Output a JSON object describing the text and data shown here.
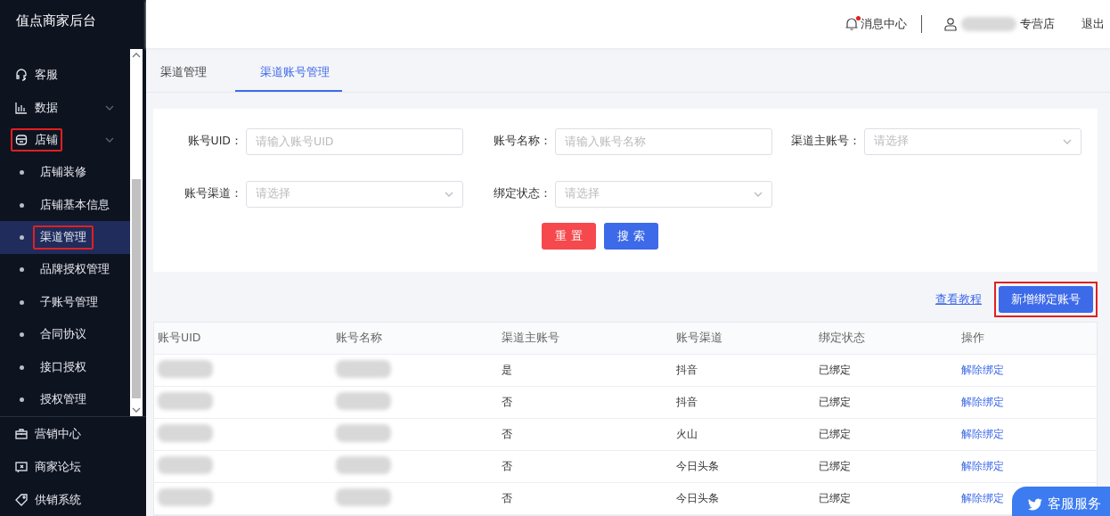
{
  "sidebar": {
    "title": "值点商家后台",
    "items": [
      {
        "label": "客服",
        "kind": "headset",
        "expandable": false,
        "highlighted": false
      },
      {
        "label": "数据",
        "kind": "chart",
        "expandable": true,
        "highlighted": false
      },
      {
        "label": "店铺",
        "kind": "shop",
        "expandable": true,
        "highlighted": true,
        "children": [
          {
            "label": "店铺装修",
            "selected": false,
            "highlighted": false
          },
          {
            "label": "店铺基本信息",
            "selected": false,
            "highlighted": false
          },
          {
            "label": "渠道管理",
            "selected": true,
            "highlighted": true
          },
          {
            "label": "品牌授权管理",
            "selected": false,
            "highlighted": false
          },
          {
            "label": "子账号管理",
            "selected": false,
            "highlighted": false
          },
          {
            "label": "合同协议",
            "selected": false,
            "highlighted": false
          },
          {
            "label": "接口授权",
            "selected": false,
            "highlighted": false
          },
          {
            "label": "授权管理",
            "selected": false,
            "highlighted": false
          }
        ]
      }
    ],
    "footer_items": [
      {
        "label": "营销中心",
        "kind": "briefcase"
      },
      {
        "label": "商家论坛",
        "kind": "forum"
      },
      {
        "label": "供销系统",
        "kind": "tag"
      }
    ]
  },
  "header": {
    "notifications": {
      "label": "消息中心",
      "unread": true
    },
    "shop_name_suffix": "专营店",
    "logout": "退出"
  },
  "tabs": [
    {
      "label": "渠道管理",
      "selected": false
    },
    {
      "label": "渠道账号管理",
      "selected": true
    }
  ],
  "filters": [
    {
      "label": "账号UID：",
      "kind": "input",
      "placeholder": "请输入账号UID"
    },
    {
      "label": "账号名称：",
      "kind": "input",
      "placeholder": "请输入账号名称"
    },
    {
      "label": "渠道主账号：",
      "kind": "select",
      "placeholder": "请选择"
    },
    {
      "label": "账号渠道：",
      "kind": "select",
      "placeholder": "请选择"
    },
    {
      "label": "绑定状态：",
      "kind": "select",
      "placeholder": "请选择"
    }
  ],
  "filter_buttons": [
    {
      "label": "重 置",
      "kind": "reset"
    },
    {
      "label": "搜 索",
      "kind": "search"
    }
  ],
  "toolbar": {
    "tutorial_link": "查看教程",
    "add_button": {
      "label": "新增绑定账号",
      "highlighted": true
    }
  },
  "table": {
    "columns": [
      {
        "label": "账号UID",
        "kind": "redacted"
      },
      {
        "label": "账号名称",
        "kind": "redacted"
      },
      {
        "label": "渠道主账号",
        "kind": "text"
      },
      {
        "label": "账号渠道",
        "kind": "text"
      },
      {
        "label": "绑定状态",
        "kind": "text"
      },
      {
        "label": "操作",
        "kind": "link"
      }
    ],
    "rows": [
      {
        "cells": [
          "",
          "",
          "是",
          "抖音",
          "已绑定",
          "解除绑定"
        ]
      },
      {
        "cells": [
          "",
          "",
          "否",
          "抖音",
          "已绑定",
          "解除绑定"
        ]
      },
      {
        "cells": [
          "",
          "",
          "否",
          "火山",
          "已绑定",
          "解除绑定"
        ]
      },
      {
        "cells": [
          "",
          "",
          "否",
          "今日头条",
          "已绑定",
          "解除绑定"
        ]
      },
      {
        "cells": [
          "",
          "",
          "否",
          "今日头条",
          "已绑定",
          "解除绑定"
        ]
      }
    ]
  },
  "support_button": "客服服务"
}
